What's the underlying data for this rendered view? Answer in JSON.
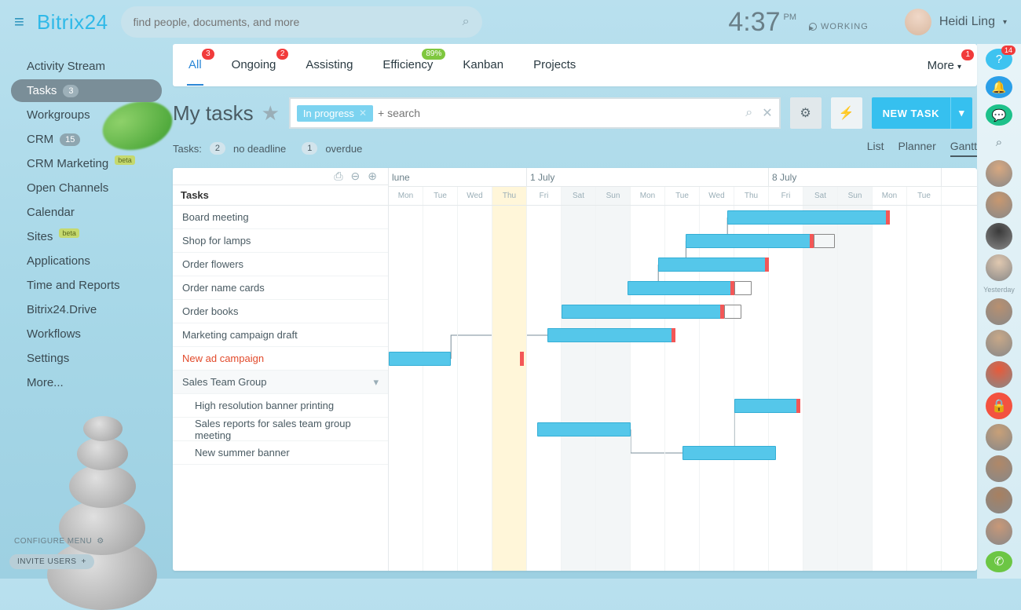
{
  "header": {
    "logo_prefix": "Bitrix",
    "logo_suffix": "24",
    "search_placeholder": "find people, documents, and more",
    "clock_time": "4:37",
    "clock_ampm": "PM",
    "working_label": "WORKING",
    "user_name": "Heidi Ling"
  },
  "sidebar": {
    "items": [
      {
        "label": "Activity Stream",
        "badge": null,
        "beta": false,
        "active": false
      },
      {
        "label": "Tasks",
        "badge": "3",
        "beta": false,
        "active": true
      },
      {
        "label": "Workgroups",
        "badge": null,
        "beta": false,
        "active": false
      },
      {
        "label": "CRM",
        "badge": "15",
        "beta": false,
        "active": false
      },
      {
        "label": "CRM Marketing",
        "badge": null,
        "beta": true,
        "active": false
      },
      {
        "label": "Open Channels",
        "badge": null,
        "beta": false,
        "active": false
      },
      {
        "label": "Calendar",
        "badge": null,
        "beta": false,
        "active": false
      },
      {
        "label": "Sites",
        "badge": null,
        "beta": true,
        "active": false
      },
      {
        "label": "Applications",
        "badge": null,
        "beta": false,
        "active": false
      },
      {
        "label": "Time and Reports",
        "badge": null,
        "beta": false,
        "active": false
      },
      {
        "label": "Bitrix24.Drive",
        "badge": null,
        "beta": false,
        "active": false
      },
      {
        "label": "Workflows",
        "badge": null,
        "beta": false,
        "active": false
      },
      {
        "label": "Settings",
        "badge": null,
        "beta": false,
        "active": false
      },
      {
        "label": "More...",
        "badge": null,
        "beta": false,
        "active": false
      }
    ],
    "beta_label": "beta",
    "configure_label": "CONFIGURE MENU",
    "invite_label": "INVITE USERS"
  },
  "tabs": [
    {
      "label": "All",
      "badge": "3",
      "badge_color": "red",
      "active": true
    },
    {
      "label": "Ongoing",
      "badge": "2",
      "badge_color": "red",
      "active": false
    },
    {
      "label": "Assisting",
      "badge": null,
      "badge_color": null,
      "active": false
    },
    {
      "label": "Efficiency",
      "badge": "89%",
      "badge_color": "green",
      "active": false
    },
    {
      "label": "Kanban",
      "badge": null,
      "badge_color": null,
      "active": false
    },
    {
      "label": "Projects",
      "badge": null,
      "badge_color": null,
      "active": false
    }
  ],
  "tabs_more": {
    "label": "More",
    "badge": "1"
  },
  "page": {
    "title": "My tasks",
    "filter_tag": "In progress",
    "filter_placeholder": "+ search",
    "new_task_label": "NEW TASK"
  },
  "status": {
    "prefix": "Tasks:",
    "no_deadline_count": "2",
    "no_deadline_label": "no deadline",
    "overdue_count": "1",
    "overdue_label": "overdue"
  },
  "views": [
    {
      "label": "List",
      "active": false
    },
    {
      "label": "Planner",
      "active": false
    },
    {
      "label": "Gantt",
      "active": true
    }
  ],
  "gantt": {
    "left_header": "Tasks",
    "months": [
      {
        "label": "lune",
        "span": 4
      },
      {
        "label": "1 July",
        "span": 7
      },
      {
        "label": "8 July",
        "span": 5
      }
    ],
    "days": [
      "Mon",
      "Tue",
      "Wed",
      "Thu",
      "Fri",
      "Sat",
      "Sun",
      "Mon",
      "Tue",
      "Wed",
      "Thu",
      "Fri",
      "Sat",
      "Sun",
      "Mon",
      "Tue"
    ],
    "weekend_idx": [
      5,
      6,
      12,
      13
    ],
    "today_idx": 3,
    "tasks": [
      {
        "label": "Board meeting",
        "sub": false,
        "red": false,
        "group": false
      },
      {
        "label": "Shop for lamps",
        "sub": false,
        "red": false,
        "group": false
      },
      {
        "label": "Order flowers",
        "sub": false,
        "red": false,
        "group": false
      },
      {
        "label": "Order name cards",
        "sub": false,
        "red": false,
        "group": false
      },
      {
        "label": "Order books",
        "sub": false,
        "red": false,
        "group": false
      },
      {
        "label": "Marketing campaign draft",
        "sub": false,
        "red": false,
        "group": false
      },
      {
        "label": "New ad campaign",
        "sub": false,
        "red": true,
        "group": false
      },
      {
        "label": "Sales Team Group",
        "sub": false,
        "red": false,
        "group": true
      },
      {
        "label": "High resolution banner printing",
        "sub": true,
        "red": false,
        "group": false
      },
      {
        "label": "Sales reports for sales team group meeting",
        "sub": true,
        "red": false,
        "group": false
      },
      {
        "label": "New summer banner",
        "sub": true,
        "red": false,
        "group": false
      }
    ],
    "bars": [
      {
        "row": 0,
        "start": 9.8,
        "len": 4.7,
        "end": true
      },
      {
        "row": 1,
        "start": 8.6,
        "len": 3.7,
        "end": true
      },
      {
        "row": 1,
        "start": 12.3,
        "len": 0.6,
        "outline": true
      },
      {
        "row": 2,
        "start": 7.8,
        "len": 3.2,
        "end": true
      },
      {
        "row": 3,
        "start": 6.9,
        "len": 3.1,
        "end": true
      },
      {
        "row": 3,
        "start": 10.0,
        "len": 0.5,
        "outline": true
      },
      {
        "row": 4,
        "start": 5.0,
        "len": 4.7,
        "end": true
      },
      {
        "row": 4,
        "start": 9.7,
        "len": 0.5,
        "outline": true
      },
      {
        "row": 5,
        "start": 4.6,
        "len": 3.7,
        "end": true
      },
      {
        "row": 6,
        "start": 0.0,
        "len": 1.8,
        "end": false
      },
      {
        "row": 6,
        "start": 3.8,
        "len": 0.1,
        "end": true
      },
      {
        "row": 8,
        "start": 10.0,
        "len": 1.9,
        "end": true
      },
      {
        "row": 9,
        "start": 4.3,
        "len": 2.7,
        "end": false
      },
      {
        "row": 10,
        "start": 8.5,
        "len": 2.7,
        "end": false
      }
    ]
  },
  "rightbar": {
    "help_badge": "14",
    "yesterday_label": "Yesterday",
    "avatars_count": 12
  }
}
